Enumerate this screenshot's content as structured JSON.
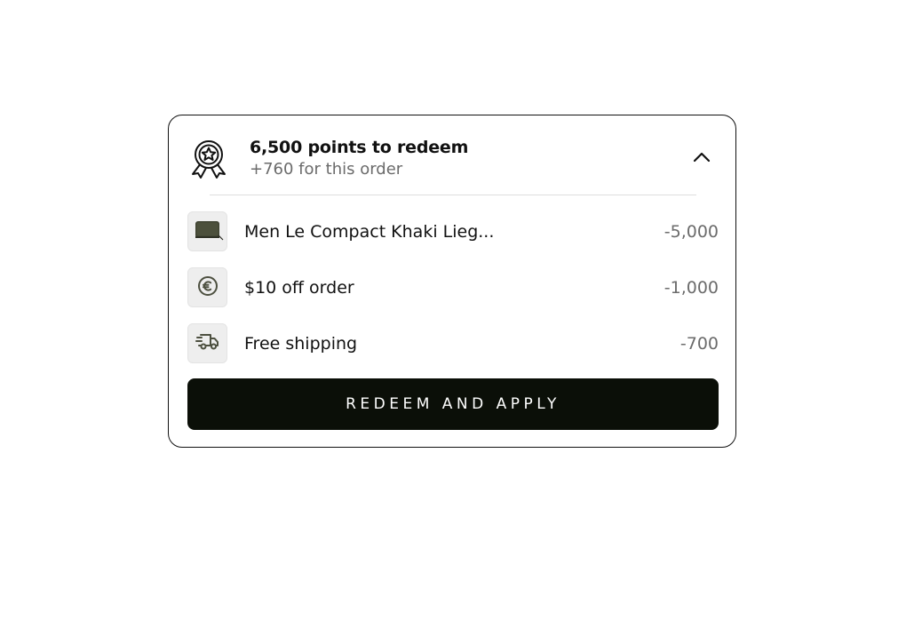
{
  "points": {
    "title": "6,500 points to redeem",
    "subtitle": "+760 for this order"
  },
  "icons": {
    "header": "award-ribbon-icon",
    "collapse": "chevron-up-icon"
  },
  "rewards": [
    {
      "label": "Men Le Compact Khaki Lieg...",
      "value": "-5,000",
      "icon": "wallet-thumbnail"
    },
    {
      "label": "$10 off order",
      "value": "-1,000",
      "icon": "euro-coin-icon"
    },
    {
      "label": "Free shipping",
      "value": "-700",
      "icon": "delivery-truck-icon"
    }
  ],
  "actions": {
    "redeem_label": "REDEEM AND APPLY"
  },
  "colors": {
    "button_bg": "#0b0f08",
    "icon_color": "#4d5040",
    "muted_text": "#6b6b6b"
  }
}
